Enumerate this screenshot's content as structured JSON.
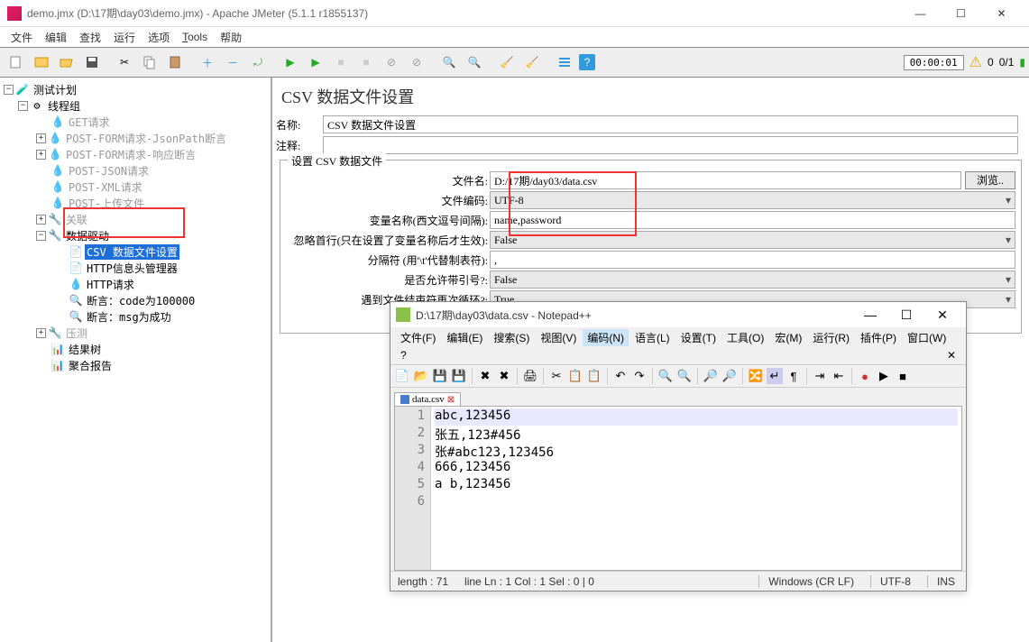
{
  "window": {
    "title": "demo.jmx (D:\\17期\\day03\\demo.jmx) - Apache JMeter (5.1.1 r1855137)"
  },
  "menu": {
    "file": "文件",
    "edit": "编辑",
    "search": "查找",
    "run": "运行",
    "options": "选项",
    "tools": "Tools",
    "help": "帮助"
  },
  "toolbar_right": {
    "time": "00:00:01",
    "count": "0/1"
  },
  "tree": {
    "root": "测试计划",
    "threadGroup": "线程组",
    "get": "GET请求",
    "postFormJson": "POST-FORM请求-JsonPath断言",
    "postFormResp": "POST-FORM请求-响应断言",
    "postJson": "POST-JSON请求",
    "postXml": "POST-XML请求",
    "postUpload": "POST-上传文件",
    "assoc": "关联",
    "dataDriven": "数据驱动",
    "csvConfig": "CSV 数据文件设置",
    "httpHeader": "HTTP信息头管理器",
    "httpReq": "HTTP请求",
    "assertCode": "断言：code为100000",
    "assertMsg": "断言：msg为成功",
    "stress": "压测",
    "resultTree": "结果树",
    "aggReport": "聚合报告"
  },
  "main": {
    "title": "CSV 数据文件设置",
    "nameLabel": "名称:",
    "nameValue": "CSV 数据文件设置",
    "commentLabel": "注释:",
    "commentValue": "",
    "fieldset": "设置 CSV 数据文件",
    "fileNameLabel": "文件名:",
    "fileNameValue": "D:/17期/day03/data.csv",
    "browse": "浏览..",
    "encodingLabel": "文件编码:",
    "encodingValue": "UTF-8",
    "varLabel": "变量名称(西文逗号间隔):",
    "varValue": "name,password",
    "ignoreLabel": "忽略首行(只在设置了变量名称后才生效):",
    "ignoreValue": "False",
    "delimLabel": "分隔符 (用'\\t'代替制表符):",
    "delimValue": ",",
    "quoteLabel": "是否允许带引号?:",
    "quoteValue": "False",
    "recycleLabel": "遇到文件结束符再次循环?:",
    "recycleValue": "True",
    "stopLabel": "遇到文"
  },
  "npp": {
    "title": "D:\\17期\\day03\\data.csv - Notepad++",
    "menu": {
      "file": "文件(F)",
      "edit": "编辑(E)",
      "search": "搜索(S)",
      "view": "视图(V)",
      "encoding": "编码(N)",
      "lang": "语言(L)",
      "settings": "设置(T)",
      "tools": "工具(O)",
      "macro": "宏(M)",
      "run": "运行(R)",
      "plugins": "插件(P)",
      "window": "窗口(W)",
      "help": "?"
    },
    "tab": "data.csv",
    "lines": [
      "abc,123456",
      "张五,123#456",
      "张#abc123,123456",
      "666,123456",
      "a b,123456",
      ""
    ],
    "status": {
      "length": "length : 71",
      "pos": "line  Ln : 1    Col : 1    Sel : 0 | 0",
      "eol": "Windows (CR LF)",
      "enc": "UTF-8",
      "mode": "INS"
    }
  }
}
